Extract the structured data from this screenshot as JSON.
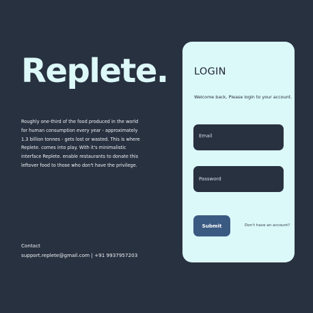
{
  "brand": {
    "name": "Replete."
  },
  "about": {
    "text": "Roughly one-third of the food produced in the world for human consumption every year - approximately 1.3 billion tonnes - gets lost or wasted. This is where Replete. comes into play. With it's minimalistic interface Replete. enable restaurants to donate this leftover food to those who don't have the privilege."
  },
  "contact": {
    "heading": "Contact",
    "details": "support.replete@gmail.com | +91 9937957203"
  },
  "login": {
    "title": "LOGIN",
    "welcome": "Welcome back, Please login to your account.",
    "email_placeholder": "Email",
    "password_placeholder": "Password",
    "submit_label": "Submit",
    "signup_link": "Don't have an account?"
  },
  "colors": {
    "background": "#283140",
    "card": "#dcf9fa",
    "brand_text": "#dcf8f8",
    "button": "#3b5a82"
  }
}
